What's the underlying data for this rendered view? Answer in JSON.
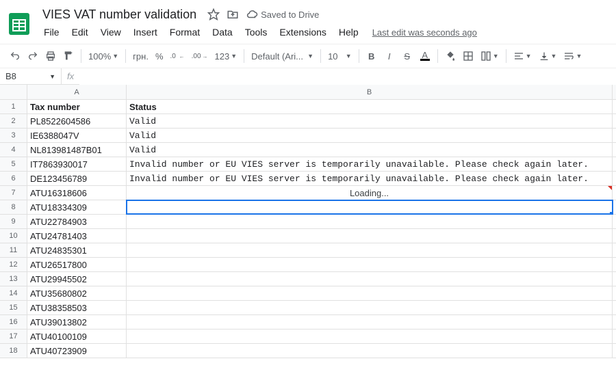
{
  "header": {
    "title": "VIES VAT number validation",
    "saved_text": "Saved to Drive",
    "menus": [
      "File",
      "Edit",
      "View",
      "Insert",
      "Format",
      "Data",
      "Tools",
      "Extensions",
      "Help"
    ],
    "last_edit": "Last edit was seconds ago"
  },
  "toolbar": {
    "zoom": "100%",
    "currency": "грн.",
    "percent": "%",
    "dec_dec": ".0",
    "inc_dec": ".00",
    "num_format": "123",
    "font": "Default (Ari...",
    "font_size": "10"
  },
  "namebox": {
    "ref": "B8",
    "fx": "fx",
    "value": ""
  },
  "columns": [
    "A",
    "B"
  ],
  "sheet": {
    "header_row": {
      "a": "Tax number",
      "b": "Status"
    },
    "rows": [
      {
        "a": "PL8522604586",
        "b": "Valid",
        "note": false
      },
      {
        "a": "IE6388047V",
        "b": "Valid",
        "note": false
      },
      {
        "a": "NL813981487B01",
        "b": "Valid",
        "note": false
      },
      {
        "a": "IT7863930017",
        "b": "Invalid number or EU VIES server is temporarily unavailable. Please check again later.",
        "note": false
      },
      {
        "a": "DE123456789",
        "b": "Invalid number or EU VIES server is temporarily unavailable. Please check again later.",
        "note": false
      },
      {
        "a": "ATU16318606",
        "b": "Loading...",
        "loading": true,
        "note": true
      },
      {
        "a": "ATU18334309",
        "b": "",
        "selected": true,
        "note": false
      },
      {
        "a": "ATU22784903",
        "b": "",
        "note": false
      },
      {
        "a": "ATU24781403",
        "b": "",
        "note": false
      },
      {
        "a": "ATU24835301",
        "b": "",
        "note": false
      },
      {
        "a": "ATU26517800",
        "b": "",
        "note": false
      },
      {
        "a": "ATU29945502",
        "b": "",
        "note": false
      },
      {
        "a": "ATU35680802",
        "b": "",
        "note": false
      },
      {
        "a": "ATU38358503",
        "b": "",
        "note": false
      },
      {
        "a": "ATU39013802",
        "b": "",
        "note": false
      },
      {
        "a": "ATU40100109",
        "b": "",
        "note": false
      },
      {
        "a": "ATU40723909",
        "b": "",
        "note": false
      }
    ]
  }
}
